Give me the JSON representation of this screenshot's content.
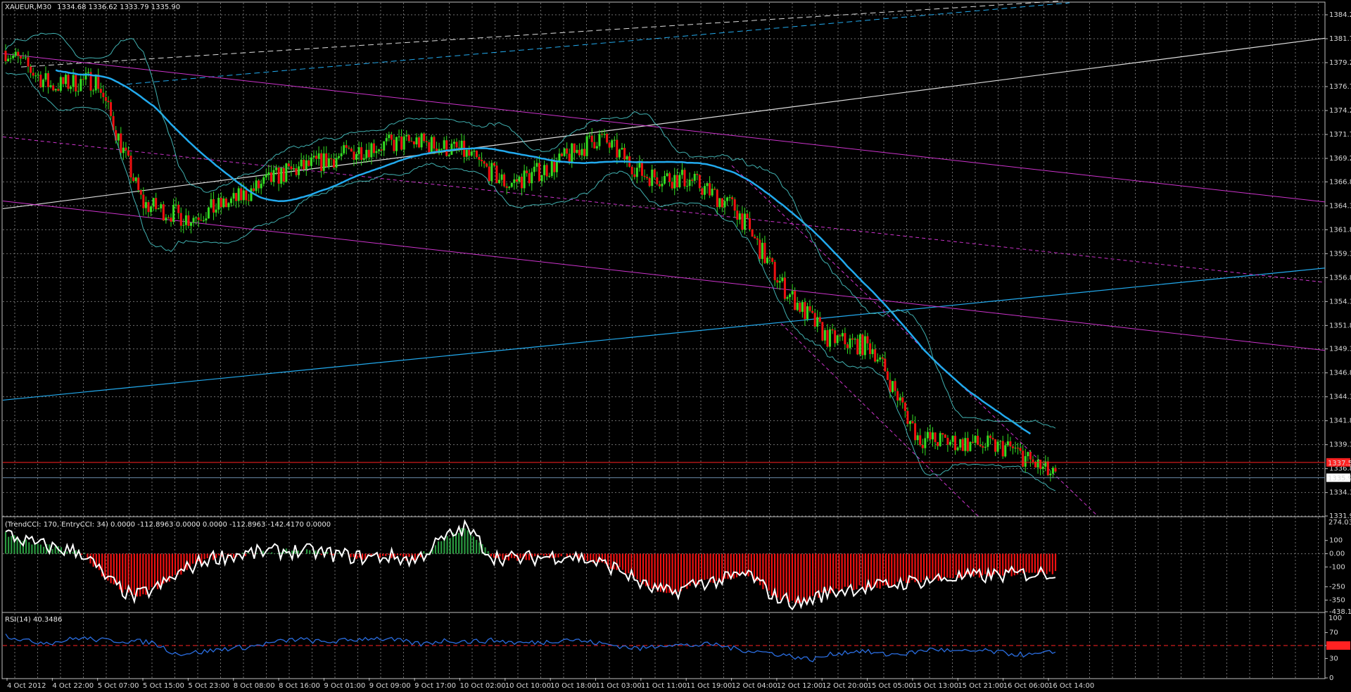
{
  "symbol": {
    "name": "XAUEUR,M30",
    "ohlc": "1334.68 1336.62 1333.79 1335.90"
  },
  "colors": {
    "background": "#000000",
    "grid": "#6f6f6f",
    "bull": "#33dd22",
    "bear": "#ee1111",
    "ma": "#22aaee",
    "channel": "#cc33cc",
    "bb": "#40b0b0",
    "trend_white": "#dddddd",
    "cci_white": "#ffffff",
    "rsi": "#2a6de0",
    "price_line": "#ff2222",
    "bid_line": "#6a8aa8"
  },
  "price_axis": {
    "ticks": [
      "1384.25",
      "1381.75",
      "1379.25",
      "1376.75",
      "1374.25",
      "1371.75",
      "1369.25",
      "1366.80",
      "1364.30",
      "1361.80",
      "1359.30",
      "1356.80",
      "1354.30",
      "1351.80",
      "1349.35",
      "1346.85",
      "1344.35",
      "1341.85",
      "1339.35",
      "1336.85",
      "1334.35",
      "1331.90"
    ],
    "current_price": "1335.90",
    "red_level": "1337.50",
    "ylim": [
      1331.9,
      1385.5
    ]
  },
  "time_axis": {
    "labels": [
      "4 Oct 2012",
      "4 Oct 22:00",
      "5 Oct 07:00",
      "5 Oct 15:00",
      "5 Oct 23:00",
      "8 Oct 08:00",
      "8 Oct 16:00",
      "9 Oct 01:00",
      "9 Oct 09:00",
      "9 Oct 17:00",
      "10 Oct 02:00",
      "10 Oct 10:00",
      "10 Oct 18:00",
      "11 Oct 03:00",
      "11 Oct 11:00",
      "11 Oct 19:00",
      "12 Oct 04:00",
      "12 Oct 12:00",
      "12 Oct 20:00",
      "15 Oct 05:00",
      "15 Oct 13:00",
      "15 Oct 21:00",
      "16 Oct 06:00",
      "16 Oct 14:00"
    ]
  },
  "cci_panel": {
    "header": "(TrendCCI: 170, EntryCCI: 34)  0.0000 -112.8963 0.0000 0.0000 -112.8963 -142.4170 0.0000",
    "top_label": "274.0339",
    "ticks": [
      "100",
      "0.00",
      "-100",
      "-250",
      "-350",
      "-438.114"
    ]
  },
  "rsi_panel": {
    "header": "RSI(14) 40.3486",
    "top_label": "100",
    "ticks": [
      "70",
      "50.00",
      "30",
      "0"
    ]
  },
  "chart_data": [
    {
      "type": "candlestick",
      "title": "XAUEUR,M30",
      "ylim": [
        1331.9,
        1385.5
      ],
      "key_points": [
        {
          "t": "4 Oct 2012",
          "close": 1380.5
        },
        {
          "t": "4 Oct 22:00",
          "close": 1376.8
        },
        {
          "t": "5 Oct 07:00",
          "close": 1377.5
        },
        {
          "t": "5 Oct 15:00",
          "close": 1364.5
        },
        {
          "t": "5 Oct 23:00",
          "close": 1363.0
        },
        {
          "t": "8 Oct 08:00",
          "close": 1364.8
        },
        {
          "t": "8 Oct 16:00",
          "close": 1367.5
        },
        {
          "t": "9 Oct 01:00",
          "close": 1369.0
        },
        {
          "t": "9 Oct 09:00",
          "close": 1370.5
        },
        {
          "t": "9 Oct 17:00",
          "close": 1371.0
        },
        {
          "t": "10 Oct 02:00",
          "close": 1370.0
        },
        {
          "t": "10 Oct 10:00",
          "close": 1366.5
        },
        {
          "t": "10 Oct 18:00",
          "close": 1368.5
        },
        {
          "t": "11 Oct 03:00",
          "close": 1371.5
        },
        {
          "t": "11 Oct 11:00",
          "close": 1367.5
        },
        {
          "t": "11 Oct 19:00",
          "close": 1367.0
        },
        {
          "t": "12 Oct 04:00",
          "close": 1364.0
        },
        {
          "t": "12 Oct 12:00",
          "close": 1356.0
        },
        {
          "t": "12 Oct 20:00",
          "close": 1350.5
        },
        {
          "t": "15 Oct 05:00",
          "close": 1349.5
        },
        {
          "t": "15 Oct 13:00",
          "close": 1340.0
        },
        {
          "t": "15 Oct 21:00",
          "close": 1339.5
        },
        {
          "t": "16 Oct 06:00",
          "close": 1339.0
        },
        {
          "t": "16 Oct 14:00",
          "close": 1335.9
        }
      ]
    },
    {
      "type": "bar",
      "title": "",
      "ylim": [
        -438.114,
        274.0339
      ],
      "series": [
        {
          "values": [
            150,
            80,
            40,
            10,
            -200,
            -330,
            -250,
            -120,
            -30,
            -10,
            10,
            20,
            15,
            -10,
            -30,
            -20,
            -50,
            100,
            200,
            -20,
            -40,
            -25,
            -10,
            -60,
            -120,
            -250,
            -300,
            -220,
            -200,
            -150,
            -320,
            -380,
            -300,
            -260,
            -250,
            -220,
            -200,
            -180,
            -170,
            -160,
            -150,
            -140
          ]
        }
      ]
    },
    {
      "type": "line",
      "title": "",
      "ylim": [
        0,
        100
      ],
      "series": [
        {
          "values": [
            66,
            56,
            55,
            62,
            58,
            57,
            55,
            37,
            40,
            45,
            48,
            55,
            60,
            55,
            58,
            62,
            58,
            52,
            58,
            56,
            58,
            54,
            55,
            60,
            55,
            50,
            45,
            52,
            50,
            52,
            44,
            40,
            35,
            28,
            38,
            42,
            36,
            38,
            45,
            40,
            42,
            38,
            35,
            40
          ]
        }
      ]
    }
  ]
}
